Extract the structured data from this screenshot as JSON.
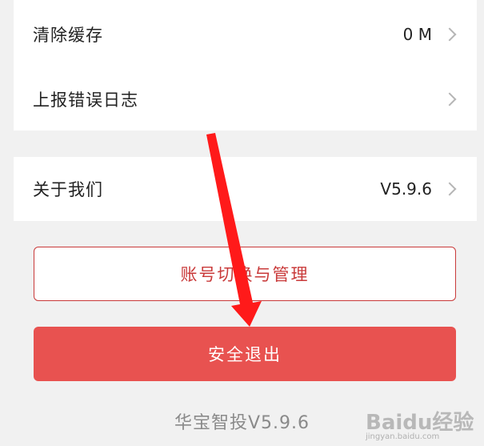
{
  "settings_list": {
    "clear_cache": {
      "label": "清除缓存",
      "value": "0 M"
    },
    "report_errors": {
      "label": "上报错误日志"
    },
    "about_us": {
      "label": "关于我们",
      "value": "V5.9.6"
    }
  },
  "buttons": {
    "switch_account": "账号切换与管理",
    "logout": "安全退出"
  },
  "footer": {
    "app_version": "华宝智投V5.9.6"
  },
  "watermark": {
    "brand": "Baidu经验",
    "url": "jingyan.baidu.com"
  },
  "colors": {
    "accent_red": "#e85250",
    "outline_red": "#c93a3a",
    "annotation_arrow": "#ff1a1a"
  }
}
